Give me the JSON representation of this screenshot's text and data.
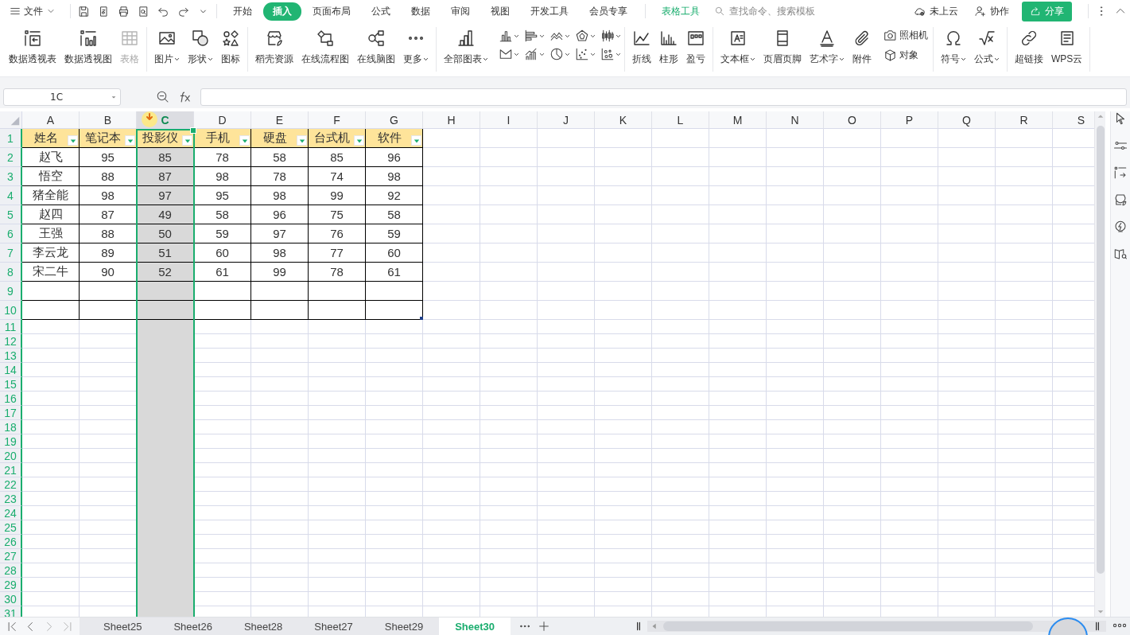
{
  "menu": {
    "label": "文件"
  },
  "tabs": [
    {
      "label": "开始",
      "selected": false
    },
    {
      "label": "插入",
      "selected": true
    },
    {
      "label": "页面布局",
      "selected": false
    },
    {
      "label": "公式",
      "selected": false
    },
    {
      "label": "数据",
      "selected": false
    },
    {
      "label": "审阅",
      "selected": false
    },
    {
      "label": "视图",
      "selected": false
    },
    {
      "label": "开发工具",
      "selected": false
    },
    {
      "label": "会员专享",
      "selected": false
    }
  ],
  "context_tab": {
    "label": "表格工具"
  },
  "search": {
    "placeholder": "查找命令、搜索模板"
  },
  "cloud_status": "未上云",
  "collaborate_button": "协作",
  "share_button": "分享",
  "ribbon": [
    {
      "kind": "large",
      "items": [
        {
          "label": "数据透视表",
          "dropdown": false,
          "disabled": false
        },
        {
          "label": "数据透视图",
          "dropdown": false,
          "disabled": false
        },
        {
          "label": "表格",
          "dropdown": false,
          "disabled": true
        }
      ]
    },
    {
      "kind": "large",
      "items": [
        {
          "label": "图片",
          "dropdown": true,
          "disabled": false
        },
        {
          "label": "形状",
          "dropdown": true,
          "disabled": false
        },
        {
          "label": "图标",
          "dropdown": false,
          "disabled": false
        }
      ]
    },
    {
      "kind": "large",
      "items": [
        {
          "label": "稻壳资源",
          "dropdown": false,
          "disabled": false
        },
        {
          "label": "在线流程图",
          "dropdown": false,
          "disabled": false
        },
        {
          "label": "在线脑图",
          "dropdown": false,
          "disabled": false
        },
        {
          "label": "更多",
          "dropdown": true,
          "disabled": false
        }
      ]
    },
    {
      "kind": "large",
      "items": [
        {
          "label": "全部图表",
          "dropdown": true,
          "disabled": false
        }
      ]
    },
    {
      "kind": "chart_grid"
    },
    {
      "kind": "large",
      "items": [
        {
          "label": "折线",
          "dropdown": false,
          "disabled": false
        },
        {
          "label": "柱形",
          "dropdown": false,
          "disabled": false
        },
        {
          "label": "盈亏",
          "dropdown": false,
          "disabled": false
        }
      ]
    },
    {
      "kind": "large",
      "items": [
        {
          "label": "文本框",
          "dropdown": true,
          "disabled": false
        },
        {
          "label": "页眉页脚",
          "dropdown": false,
          "disabled": false
        },
        {
          "label": "艺术字",
          "dropdown": true,
          "disabled": false
        },
        {
          "label": "附件",
          "dropdown": false,
          "disabled": false
        }
      ]
    },
    {
      "kind": "stack",
      "items": [
        {
          "label": "照相机"
        },
        {
          "label": "对象"
        }
      ]
    },
    {
      "kind": "large",
      "items": [
        {
          "label": "符号",
          "dropdown": true,
          "disabled": false
        },
        {
          "label": "公式",
          "dropdown": true,
          "disabled": false
        }
      ]
    },
    {
      "kind": "large",
      "items": [
        {
          "label": "超链接",
          "dropdown": false,
          "disabled": false
        },
        {
          "label": "WPS云",
          "dropdown": false,
          "disabled": false
        }
      ]
    }
  ],
  "formula_bar": {
    "name_box": "1C"
  },
  "sheet": {
    "columns": [
      {
        "label": "A",
        "selected": false
      },
      {
        "label": "B",
        "selected": false
      },
      {
        "label": "C",
        "selected": true
      },
      {
        "label": "D",
        "selected": false
      },
      {
        "label": "E",
        "selected": false
      },
      {
        "label": "F",
        "selected": false
      },
      {
        "label": "G",
        "selected": false
      },
      {
        "label": "H",
        "selected": false
      },
      {
        "label": "I",
        "selected": false
      },
      {
        "label": "J",
        "selected": false
      },
      {
        "label": "K",
        "selected": false
      },
      {
        "label": "L",
        "selected": false
      },
      {
        "label": "M",
        "selected": false
      },
      {
        "label": "N",
        "selected": false
      },
      {
        "label": "O",
        "selected": false
      },
      {
        "label": "P",
        "selected": false
      },
      {
        "label": "Q",
        "selected": false
      },
      {
        "label": "R",
        "selected": false
      },
      {
        "label": "S",
        "selected": false
      }
    ],
    "rows": [
      {
        "label": "1",
        "kind": "header",
        "cells": [
          "姓名",
          "笔记本",
          "投影仪",
          "手机",
          "硬盘",
          "台式机",
          "软件"
        ]
      },
      {
        "label": "2",
        "kind": "data",
        "cells": [
          "赵飞",
          "95",
          "85",
          "78",
          "58",
          "85",
          "96"
        ]
      },
      {
        "label": "3",
        "kind": "data",
        "cells": [
          "悟空",
          "88",
          "87",
          "98",
          "78",
          "74",
          "98"
        ]
      },
      {
        "label": "4",
        "kind": "data",
        "cells": [
          "猪全能",
          "98",
          "97",
          "95",
          "98",
          "99",
          "92"
        ]
      },
      {
        "label": "5",
        "kind": "data",
        "cells": [
          "赵四",
          "87",
          "49",
          "58",
          "96",
          "75",
          "58"
        ]
      },
      {
        "label": "6",
        "kind": "data",
        "cells": [
          "王强",
          "88",
          "50",
          "59",
          "97",
          "76",
          "59"
        ]
      },
      {
        "label": "7",
        "kind": "data",
        "cells": [
          "李云龙",
          "89",
          "51",
          "60",
          "98",
          "77",
          "60"
        ]
      },
      {
        "label": "8",
        "kind": "data",
        "cells": [
          "宋二牛",
          "90",
          "52",
          "61",
          "99",
          "78",
          "61"
        ]
      },
      {
        "label": "9",
        "kind": "empty_table"
      },
      {
        "label": "10",
        "kind": "empty_table"
      },
      {
        "label": "11",
        "kind": "plain"
      },
      {
        "label": "12",
        "kind": "plain"
      },
      {
        "label": "13",
        "kind": "plain"
      },
      {
        "label": "14",
        "kind": "plain"
      },
      {
        "label": "15",
        "kind": "plain"
      },
      {
        "label": "16",
        "kind": "plain"
      },
      {
        "label": "17",
        "kind": "plain"
      },
      {
        "label": "18",
        "kind": "plain"
      },
      {
        "label": "19",
        "kind": "plain"
      },
      {
        "label": "20",
        "kind": "plain"
      },
      {
        "label": "21",
        "kind": "plain"
      },
      {
        "label": "22",
        "kind": "plain"
      },
      {
        "label": "23",
        "kind": "plain"
      },
      {
        "label": "24",
        "kind": "plain"
      },
      {
        "label": "25",
        "kind": "plain"
      },
      {
        "label": "26",
        "kind": "plain"
      },
      {
        "label": "27",
        "kind": "plain"
      },
      {
        "label": "28",
        "kind": "plain"
      },
      {
        "label": "29",
        "kind": "plain"
      },
      {
        "label": "30",
        "kind": "plain"
      },
      {
        "label": "31",
        "kind": "plain"
      }
    ]
  },
  "sheet_tabs": [
    {
      "label": "Sheet25",
      "selected": false
    },
    {
      "label": "Sheet26",
      "selected": false
    },
    {
      "label": "Sheet28",
      "selected": false
    },
    {
      "label": "Sheet27",
      "selected": false
    },
    {
      "label": "Sheet29",
      "selected": false
    },
    {
      "label": "Sheet30",
      "selected": true
    }
  ]
}
